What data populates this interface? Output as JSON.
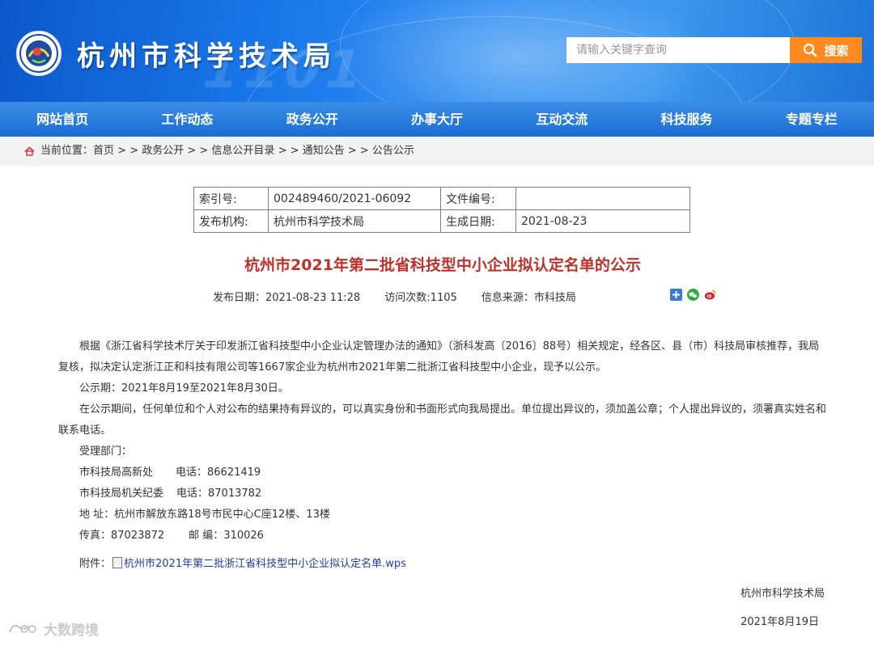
{
  "header": {
    "site_title": "杭州市科学技术局",
    "search_placeholder": "请输入关键字查询",
    "search_button": "搜索",
    "banner_watermark": "1101",
    "colors": {
      "banner": "#1976e8",
      "search_button": "#ff8a1f",
      "title_red": "#c0302a"
    }
  },
  "nav": {
    "items": [
      {
        "label": "网站首页"
      },
      {
        "label": "工作动态"
      },
      {
        "label": "政务公开"
      },
      {
        "label": "办事大厅"
      },
      {
        "label": "互动交流"
      },
      {
        "label": "科技服务"
      },
      {
        "label": "专题专栏"
      }
    ]
  },
  "breadcrumb": {
    "prefix": "当前位置：",
    "items": [
      "首页",
      "政务公开",
      "信息公开目录",
      "通知公告",
      "公告公示"
    ],
    "sep": " > > "
  },
  "meta_table": {
    "index_label": "索引号:",
    "index_value": "002489460/2021-06092",
    "docno_label": "文件编号:",
    "docno_value": "",
    "org_label": "发布机构:",
    "org_value": "杭州市科学技术局",
    "date_label": "生成日期:",
    "date_value": "2021-08-23"
  },
  "article": {
    "title": "杭州市2021年第二批省科技型中小企业拟认定名单的公示",
    "publish_date": "发布日期：2021-08-23 11:28",
    "visits": "访问次数:1105",
    "source": "信息来源：市科技局",
    "para1": "根据《浙江省科学技术厅关于印发浙江省科技型中小企业认定管理办法的通知》（浙科发高〔2016〕88号）相关规定，经各区、县（市）科技局审核推荐，我局复核，拟决定认定浙江正和科技有限公司等1667家企业为杭州市2021年第二批浙江省科技型中小企业，现予以公示。",
    "para2": "公示期：2021年8月19至2021年8月30日。",
    "para3": "在公示期间，任何单位和个人对公布的结果持有异议的，可以真实身份和书面形式向我局提出。单位提出异议的，须加盖公章；个人提出异议的，须署真实姓名和联系电话。",
    "dept_label": "受理部门：",
    "dept1_name": "市科技局高新处",
    "dept1_phone": "电话：86621419",
    "dept2_name": "市科技局机关纪委",
    "dept2_phone": "电话：87013782",
    "address": "地  址：杭州市解放东路18号市民中心C座12楼、13楼",
    "fax": "传真：87023872",
    "postcode": "邮  编：310026",
    "attach_label": "附件：",
    "attach_link": "杭州市2021年第二批浙江省科技型中小企业拟认定名单.wps",
    "sign_org": "杭州市科学技术局",
    "sign_date": "2021年8月19日"
  },
  "watermark": "大数跨境"
}
